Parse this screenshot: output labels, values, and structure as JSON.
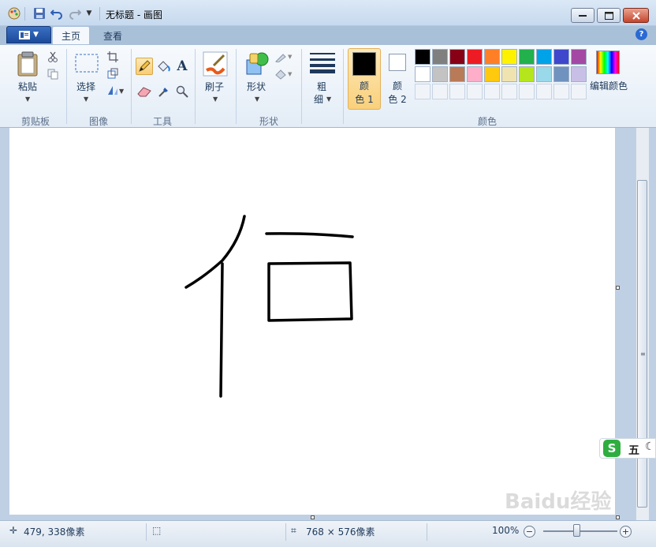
{
  "window": {
    "title": "无标题 - 画图"
  },
  "tabs": {
    "home": "主页",
    "view": "查看"
  },
  "ribbon": {
    "clipboard": {
      "paste": "粘贴",
      "group": "剪贴板"
    },
    "image": {
      "select": "选择",
      "group": "图像"
    },
    "tools": {
      "group": "工具"
    },
    "brushes": {
      "label": "刷子"
    },
    "shapes": {
      "label": "形状",
      "group": "形状"
    },
    "size": {
      "label_top": "粗",
      "label_bottom": "细"
    },
    "colors": {
      "color1_top": "颜",
      "color1_bottom": "色 1",
      "color2_top": "颜",
      "color2_bottom": "色 2",
      "edit": "编辑颜色",
      "group": "颜色",
      "color1": "#000000",
      "color2": "#ffffff",
      "palette": [
        "#000000",
        "#7f7f7f",
        "#880015",
        "#ed1c24",
        "#ff7f27",
        "#fff200",
        "#22b14c",
        "#00a2e8",
        "#3f48cc",
        "#a349a4",
        "#ffffff",
        "#c3c3c3",
        "#b97a57",
        "#ffaec9",
        "#ffc90e",
        "#efe4b0",
        "#b5e61d",
        "#99d9ea",
        "#7092be",
        "#c8bfe7"
      ]
    }
  },
  "status": {
    "cursor": "479, 338像素",
    "size": "768 × 576像素",
    "zoom": "100%"
  },
  "ime": {
    "label": "五"
  },
  "watermark": "Baidu经验"
}
